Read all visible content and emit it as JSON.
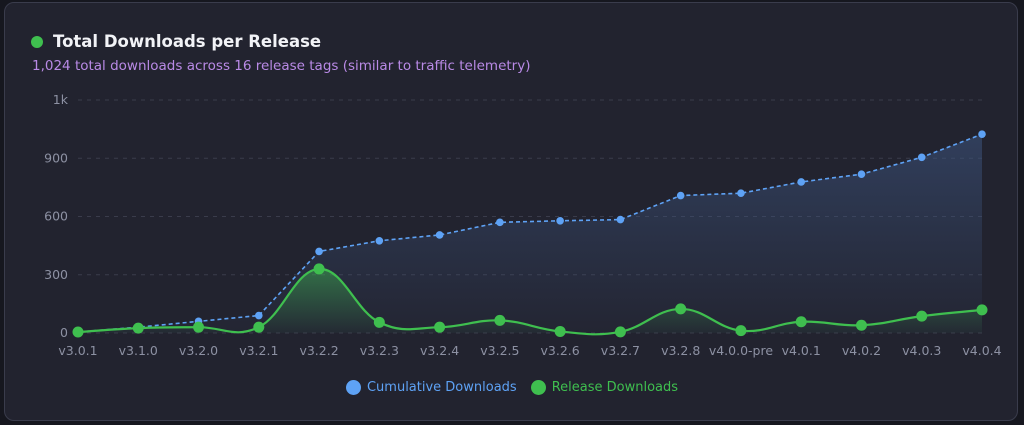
{
  "header": {
    "title": "Total Downloads per Release",
    "subtitle": "1,024 total downloads across 16 release tags (similar to traffic telemetry)"
  },
  "colors": {
    "cumulative": "#5ea2f5",
    "release": "#3fbf4f",
    "title_dot": "#3fbf4f"
  },
  "legend": [
    {
      "label": "Cumulative Downloads",
      "color": "#5ea2f5"
    },
    {
      "label": "Release Downloads",
      "color": "#3fbf4f"
    }
  ],
  "chart_data": {
    "type": "line",
    "categories": [
      "v3.0.1",
      "v3.1.0",
      "v3.2.0",
      "v3.2.1",
      "v3.2.2",
      "v3.2.3",
      "v3.2.4",
      "v3.2.5",
      "v3.2.6",
      "v3.2.7",
      "v3.2.8",
      "v4.0.0-pre",
      "v4.0.1",
      "v4.0.2",
      "v4.0.3",
      "v4.0.4"
    ],
    "series": [
      {
        "name": "Cumulative Downloads",
        "style": "dashed-area",
        "values": [
          5,
          30,
          60,
          90,
          420,
          475,
          505,
          570,
          578,
          584,
          708,
          720,
          778,
          818,
          905,
          1024
        ]
      },
      {
        "name": "Release Downloads",
        "style": "smooth-line",
        "values": [
          5,
          25,
          30,
          30,
          330,
          55,
          30,
          65,
          8,
          6,
          124,
          12,
          58,
          40,
          87,
          119
        ]
      }
    ],
    "yticks": [
      {
        "value": 0,
        "label": "0"
      },
      {
        "value": 300,
        "label": "300"
      },
      {
        "value": 600,
        "label": "600"
      },
      {
        "value": 900,
        "label": "900"
      },
      {
        "value": 1200,
        "label": "1k"
      }
    ],
    "ylim": [
      0,
      1200
    ],
    "grid": true,
    "legend_position": "bottom"
  }
}
